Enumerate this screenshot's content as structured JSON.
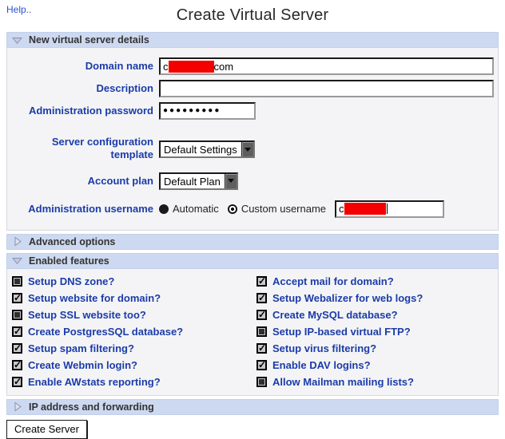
{
  "page": {
    "help_link": "Help..",
    "title": "Create Virtual Server"
  },
  "colors": {
    "section_header_bg": "#cdd9f0",
    "section_body_bg": "#f4f4f6",
    "label_blue": "#1b3ca8",
    "link_blue": "#2a4fd0",
    "redaction_red": "#f40000"
  },
  "sections": {
    "details": {
      "title": "New virtual server details",
      "expanded": true
    },
    "advanced": {
      "title": "Advanced options",
      "expanded": false
    },
    "features": {
      "title": "Enabled features",
      "expanded": true
    },
    "ip": {
      "title": "IP address and forwarding",
      "expanded": false
    }
  },
  "form": {
    "domain_name": {
      "label": "Domain name",
      "value_prefix": "c",
      "value_redacted": true,
      "value_suffix": "com"
    },
    "description": {
      "label": "Description",
      "value": "",
      "placeholder": ""
    },
    "admin_password": {
      "label": "Administration password",
      "masked_value": "●●●●●●●●●"
    },
    "template": {
      "label": "Server configuration template",
      "selected": "Default Settings"
    },
    "plan": {
      "label": "Account plan",
      "selected": "Default Plan"
    },
    "admin_username": {
      "label": "Administration username",
      "options": [
        {
          "label": "Automatic",
          "selected": false
        },
        {
          "label": "Custom username",
          "selected": true
        }
      ],
      "custom_value_prefix": "c",
      "custom_value_redacted": true
    }
  },
  "features": {
    "left": [
      {
        "label": "Setup DNS zone?",
        "checked": false
      },
      {
        "label": "Setup website for domain?",
        "checked": true
      },
      {
        "label": "Setup SSL website too?",
        "checked": false
      },
      {
        "label": "Create PostgresSQL database?",
        "checked": true
      },
      {
        "label": "Setup spam filtering?",
        "checked": true
      },
      {
        "label": "Create Webmin login?",
        "checked": true
      },
      {
        "label": "Enable AWstats reporting?",
        "checked": true
      }
    ],
    "right": [
      {
        "label": "Accept mail for domain?",
        "checked": true
      },
      {
        "label": "Setup Webalizer for web logs?",
        "checked": true
      },
      {
        "label": "Create MySQL database?",
        "checked": true
      },
      {
        "label": "Setup IP-based virtual FTP?",
        "checked": false
      },
      {
        "label": "Setup virus filtering?",
        "checked": true
      },
      {
        "label": "Enable DAV logins?",
        "checked": true
      },
      {
        "label": "Allow Mailman mailing lists?",
        "checked": false
      }
    ]
  },
  "footer": {
    "create_button": "Create Server"
  }
}
